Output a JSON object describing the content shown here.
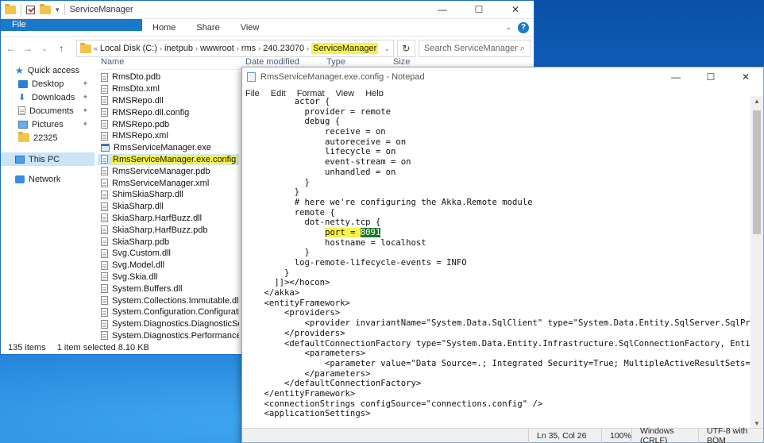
{
  "explorer": {
    "title": "ServiceManager",
    "ribbon_tabs": [
      "File",
      "Home",
      "Share",
      "View"
    ],
    "breadcrumb": [
      "Local Disk (C:)",
      "inetpub",
      "wwwroot",
      "rms",
      "240.23070",
      "ServiceManager"
    ],
    "search_placeholder": "Search ServiceManager",
    "columns": {
      "name": "Name",
      "date": "Date modified",
      "type": "Type",
      "size": "Size"
    },
    "nav": [
      {
        "label": "Quick access",
        "icon": "star-icon"
      },
      {
        "label": "Desktop",
        "icon": "desktop-icon"
      },
      {
        "label": "Downloads",
        "icon": "downloads-icon"
      },
      {
        "label": "Documents",
        "icon": "documents-icon"
      },
      {
        "label": "Pictures",
        "icon": "pictures-icon"
      },
      {
        "label": "22325",
        "icon": "folder-icon"
      },
      {
        "label": "This PC",
        "icon": "pc-icon"
      },
      {
        "label": "Network",
        "icon": "network-icon"
      }
    ],
    "files": [
      "RmsDto.pdb",
      "RmsDto.xml",
      "RMSRepo.dll",
      "RMSRepo.dll.config",
      "RMSRepo.pdb",
      "RMSRepo.xml",
      "RmsServiceManager.exe",
      "RmsServiceManager.exe.config",
      "RmsServiceManager.pdb",
      "RmsServiceManager.xml",
      "ShimSkiaSharp.dll",
      "SkiaSharp.dll",
      "SkiaSharp.HarfBuzz.dll",
      "SkiaSharp.HarfBuzz.pdb",
      "SkiaSharp.pdb",
      "Svg.Custom.dll",
      "Svg.Model.dll",
      "Svg.Skia.dll",
      "System.Buffers.dll",
      "System.Collections.Immutable.dll",
      "System.Configuration.ConfigurationMan...",
      "System.Diagnostics.DiagnosticSource.dll",
      "System.Diagnostics.PerformanceCounter..."
    ],
    "selected_file": "RmsServiceManager.exe.config",
    "status": {
      "items": "135 items",
      "selection": "1 item selected  8.10 KB"
    }
  },
  "notepad": {
    "title": "RmsServiceManager.exe.config - Notepad",
    "menu": [
      "File",
      "Edit",
      "Format",
      "View",
      "Help"
    ],
    "lines_before": [
      "          actor {",
      "            provider = remote",
      "            debug {",
      "                receive = on",
      "                autoreceive = on",
      "                lifecycle = on",
      "                event-stream = on",
      "                unhandled = on",
      "            }",
      "          }",
      "          # here we're configuring the Akka.Remote module",
      "          remote {",
      "            dot-netty.tcp {"
    ],
    "port_indent": "                ",
    "port_key": "port = ",
    "port_value": "8091",
    "lines_after": [
      "                hostname = localhost",
      "            }",
      "          log-remote-lifecycle-events = INFO",
      "        }",
      "      ]]></hocon>",
      "    </akka>",
      "    <entityFramework>",
      "        <providers>",
      "            <provider invariantName=\"System.Data.SqlClient\" type=\"System.Data.Entity.SqlServer.SqlProviderServices",
      "        </providers>",
      "        <defaultConnectionFactory type=\"System.Data.Entity.Infrastructure.SqlConnectionFactory, EntityFramework\">",
      "            <parameters>",
      "                <parameter value=\"Data Source=.; Integrated Security=True; MultipleActiveResultSets=True\" />",
      "            </parameters>",
      "        </defaultConnectionFactory>",
      "    </entityFramework>",
      "    <connectionStrings configSource=\"connections.config\" />",
      "    <applicationSettings>"
    ],
    "status": {
      "position": "Ln 35, Col 26",
      "zoom": "100%",
      "line_ending": "Windows (CRLF)",
      "encoding": "UTF-8 with BOM"
    }
  }
}
